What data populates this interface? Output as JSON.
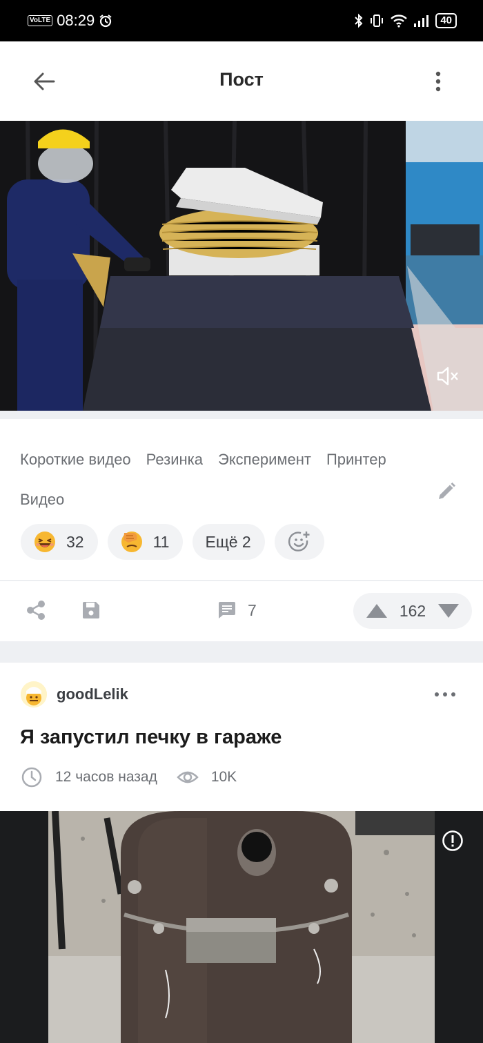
{
  "status_bar": {
    "volte": "VoLTE",
    "time": "08:29",
    "battery": "40"
  },
  "app_bar": {
    "title": "Пост"
  },
  "post": {
    "tags": [
      "Короткие видео",
      "Резинка",
      "Эксперимент",
      "Принтер",
      "Видео"
    ],
    "reactions": [
      {
        "emoji": "laughing-face",
        "count": "32"
      },
      {
        "emoji": "facepalm",
        "count": "11"
      }
    ],
    "more_reactions_label": "Ещё 2",
    "comments_count": "7",
    "rating": "162"
  },
  "next_post": {
    "author": "goodLelik",
    "title": "Я запустил печку в гараже",
    "time_ago": "12 часов назад",
    "views": "10K"
  },
  "colors": {
    "accent_icon": "#a9acb2",
    "pill_bg": "#f2f3f5",
    "text_secondary": "#6b6e73"
  }
}
